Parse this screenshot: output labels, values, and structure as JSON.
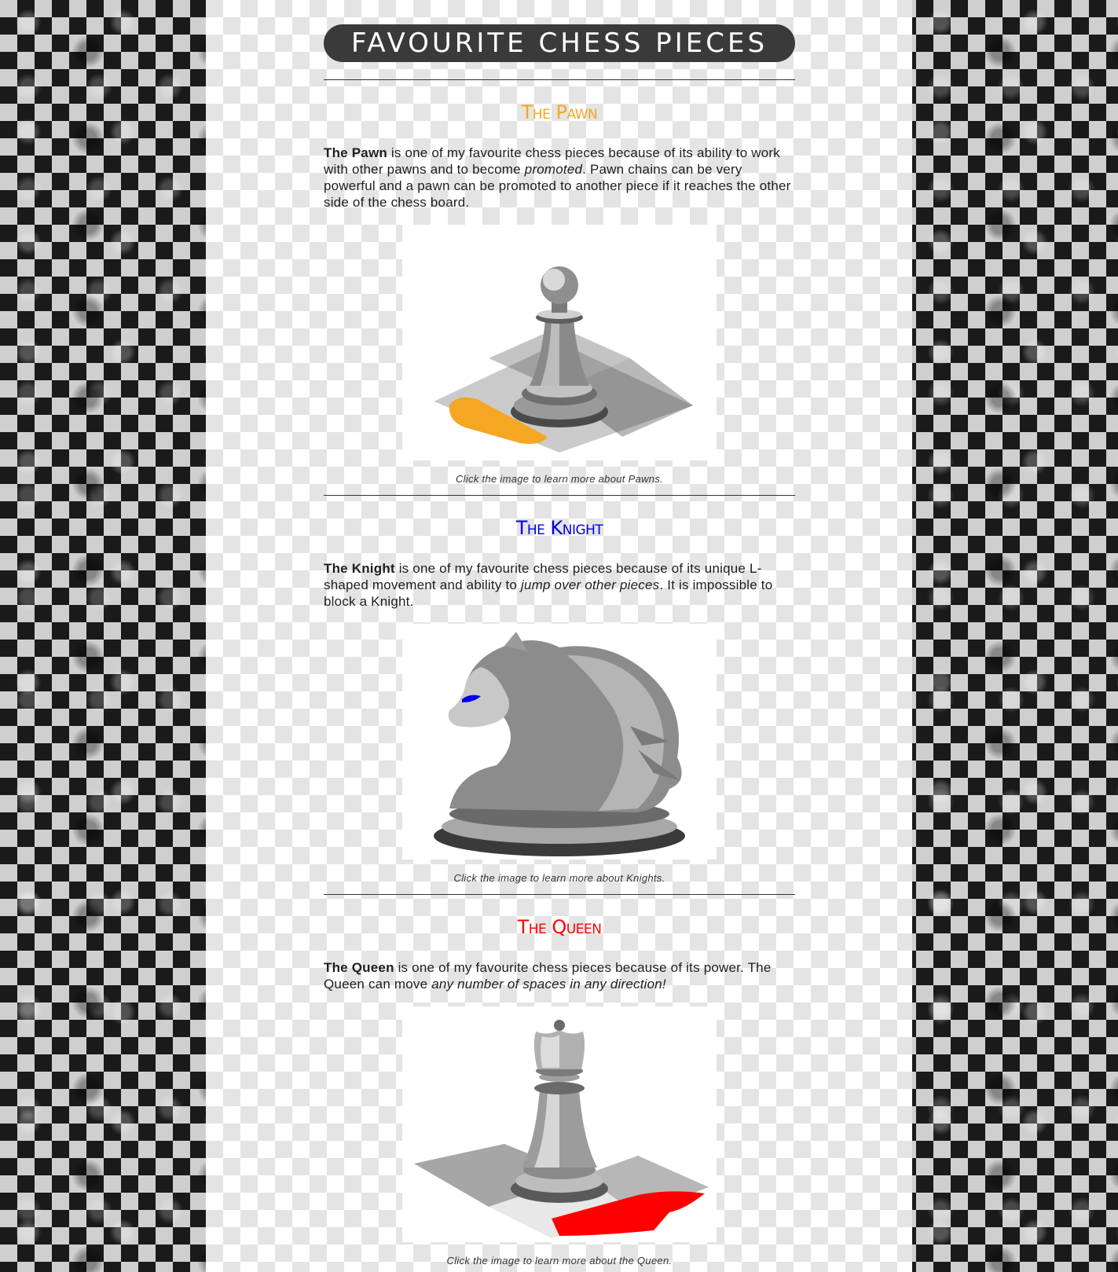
{
  "page_title": "FAVOURITE CHESS PIECES",
  "colors": {
    "banner_bg": "#3a3a3a",
    "pawn_accent": "#f5a623",
    "knight_accent": "#0000e6",
    "queen_accent": "#ff0000"
  },
  "sections": [
    {
      "heading": "The Pawn",
      "bold": "The Pawn",
      "text_a": " is one of my favourite chess pieces because of its ability to work with other pawns and to become ",
      "italic": "promoted",
      "text_b": ". Pawn chains can be very powerful and a pawn can be promoted to another piece if it reaches the other side of the chess board.",
      "image_icon": "pawn-drawing",
      "caption": "Click the image to learn more about Pawns."
    },
    {
      "heading": "The Knight",
      "bold": "The Knight",
      "text_a": " is one of my favourite chess pieces because of its unique L-shaped movement and ability to ",
      "italic": "jump over other pieces",
      "text_b": ". It is impossible to block a Knight.",
      "image_icon": "knight-drawing",
      "caption": "Click the image to learn more about Knights."
    },
    {
      "heading": "The Queen",
      "bold": "The Queen",
      "text_a": " is one of my favourite chess pieces because of its power. The Queen can move ",
      "italic": "any number of spaces in any direction!",
      "text_b": "",
      "image_icon": "queen-drawing",
      "caption": "Click the image to learn more about the Queen."
    }
  ]
}
